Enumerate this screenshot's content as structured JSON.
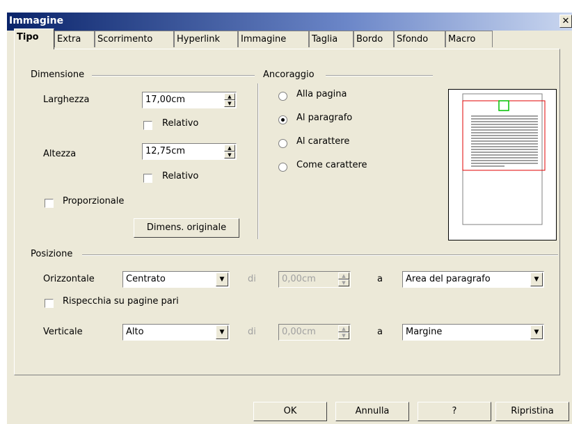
{
  "window": {
    "title": "Immagine",
    "close_glyph": "✕"
  },
  "tabs": [
    {
      "label": "Tipo",
      "active": true
    },
    {
      "label": "Extra"
    },
    {
      "label": "Scorrimento"
    },
    {
      "label": "Hyperlink"
    },
    {
      "label": "Immagine"
    },
    {
      "label": "Taglia"
    },
    {
      "label": "Bordo"
    },
    {
      "label": "Sfondo"
    },
    {
      "label": "Macro"
    }
  ],
  "dimensione": {
    "group_label": "Dimensione",
    "width_label": "Larghezza",
    "width_value": "17,00cm",
    "width_relative": "Relativo",
    "height_label": "Altezza",
    "height_value": "12,75cm",
    "height_relative": "Relativo",
    "proportional": "Proporzionale",
    "original_button": "Dimens. originale"
  },
  "ancoraggio": {
    "group_label": "Ancoraggio",
    "options": [
      "Alla pagina",
      "Al paragrafo",
      "Al carattere",
      "Come carattere"
    ],
    "selected_index": 1
  },
  "posizione": {
    "group_label": "Posizione",
    "horizontal_label": "Orizzontale",
    "horizontal_value": "Centrato",
    "h_di": "di",
    "h_offset": "0,00cm",
    "h_a": "a",
    "h_to": "Area del paragrafo",
    "mirror_label": "Rispecchia su pagine pari",
    "vertical_label": "Verticale",
    "vertical_value": "Alto",
    "v_di": "di",
    "v_offset": "0,00cm",
    "v_a": "a",
    "v_to": "Margine"
  },
  "buttons": {
    "ok": "OK",
    "cancel": "Annulla",
    "help": "?",
    "reset": "Ripristina"
  }
}
